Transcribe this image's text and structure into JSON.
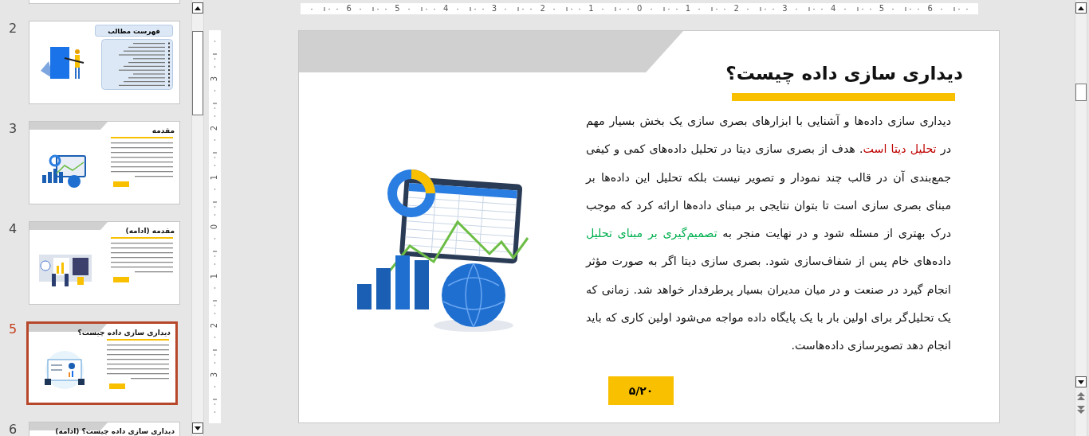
{
  "thumbnails": [
    {
      "kind": "cut",
      "selected": false
    },
    {
      "kind": "toc",
      "number": "2",
      "title": "فهرست مطالب",
      "selected": false
    },
    {
      "kind": "content",
      "number": "3",
      "title": "مقدمه",
      "selected": false
    },
    {
      "kind": "content",
      "number": "4",
      "title": "مقدمه (ادامه)",
      "selected": false
    },
    {
      "kind": "content",
      "number": "5",
      "title": "دیداری سازی داده چیست؟",
      "selected": true
    },
    {
      "kind": "content",
      "number": "6",
      "title": "دیداری سازی داده چیست؟ (ادامه)",
      "selected": false
    }
  ],
  "horizontal_ruler": [
    "6",
    "5",
    "4",
    "3",
    "2",
    "1",
    "0",
    "1",
    "2",
    "3",
    "4",
    "5",
    "6"
  ],
  "vertical_ruler": [
    "3",
    "2",
    "1",
    "0",
    "1",
    "2",
    "3"
  ],
  "slide": {
    "title": "دیداری سازی داده چیست؟",
    "paragraph": [
      {
        "kind": "plain",
        "text": "دیداری سازی داده‌ها و آشنایی با ابزارهای بصری سازی یک بخش بسیار مهم در "
      },
      {
        "kind": "highlight",
        "text": "تحلیل دیتا است"
      },
      {
        "kind": "plain",
        "text": ". هدف از بصری سازی دیتا در تحلیل داده‌های کمی و کیفی جمع‌بندی آن در قالب چند نمودار و تصویر نیست بلکه تحلیل این داده‌ها بر مبنای بصری سازی است تا بتوان نتایجی بر مبنای داده‌ها ارائه کرد که موجب درک بهتری از مسئله شود و در نهایت منجر به "
      },
      {
        "kind": "key",
        "text": "تصمیم‌گیری بر مبنای تحلیل"
      },
      {
        "kind": "plain",
        "text": " داده‌های خام پس از شفاف‌سازی شود. بصری سازی دیتا اگر به صورت مؤثر انجام گیرد در صنعت و در میان مدیران بسیار پرطرفدار خواهد شد. زمانی که یک تحلیل‌گر برای اولین بار با یک پایگاه داده مواجه می‌شود اولین کاری که باید انجام دهد تصویرسازی داده‌هاست."
      }
    ],
    "page_number": "۵/۲۰"
  }
}
